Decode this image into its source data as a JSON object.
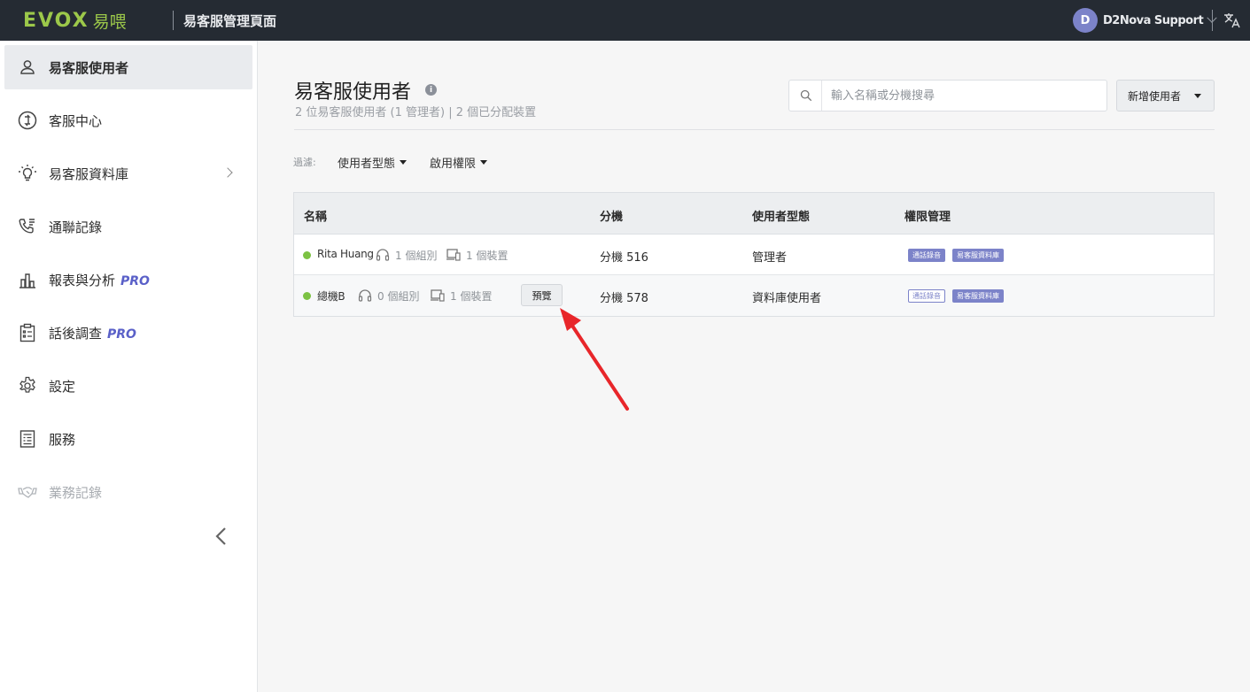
{
  "topbar": {
    "logo_text": "EVOX",
    "logo_cn": "易喂",
    "title": "易客服管理頁面",
    "avatar_initial": "D",
    "user_name": "D2Nova Support"
  },
  "sidebar": {
    "items": [
      {
        "label": "易客服使用者",
        "icon": "user-icon",
        "active": true
      },
      {
        "label": "客服中心",
        "icon": "support-center-icon"
      },
      {
        "label": "易客服資料庫",
        "icon": "lightbulb-icon",
        "has_chevron": true
      },
      {
        "label": "通聯記錄",
        "icon": "call-log-icon"
      },
      {
        "label": "報表與分析",
        "badge": "PRO",
        "icon": "bar-chart-icon"
      },
      {
        "label": "話後調查",
        "badge": "PRO",
        "icon": "clipboard-icon"
      },
      {
        "label": "設定",
        "icon": "gear-icon"
      },
      {
        "label": "服務",
        "icon": "document-icon"
      },
      {
        "label": "業務記錄",
        "icon": "handshake-icon",
        "disabled": true
      }
    ]
  },
  "main": {
    "title": "易客服使用者",
    "subtitle": "2 位易客服使用者 (1 管理者) | 2 個已分配裝置",
    "search_placeholder": "輸入名稱或分機搜尋",
    "add_user_label": "新增使用者",
    "filter_label": "過濾:",
    "filters": [
      "使用者型態",
      "啟用權限"
    ]
  },
  "table": {
    "headers": [
      "名稱",
      "分機",
      "使用者型態",
      "權限管理"
    ],
    "rows": [
      {
        "name": "Rita Huang",
        "groups": "1 個組別",
        "devices": "1 個裝置",
        "extension": "分機 516",
        "user_type": "管理者",
        "badge1": "通話錄音",
        "badge1_style": "filled",
        "badge2": "易客服資料庫",
        "status": "online"
      },
      {
        "name": "總機B",
        "groups": "0 個組別",
        "devices": "1 個裝置",
        "preview_label": "預覽",
        "extension": "分機 578",
        "user_type": "資料庫使用者",
        "badge1": "通話錄音",
        "badge1_style": "outline",
        "badge2": "易客服資料庫",
        "status": "online"
      }
    ]
  },
  "colors": {
    "topbar_bg": "#252b33",
    "brand_green": "#9cc84a",
    "accent_purple": "#7c83c9",
    "pro_color": "#5a60c8",
    "status_online": "#7cc243",
    "annotation_arrow": "#e8262a"
  }
}
